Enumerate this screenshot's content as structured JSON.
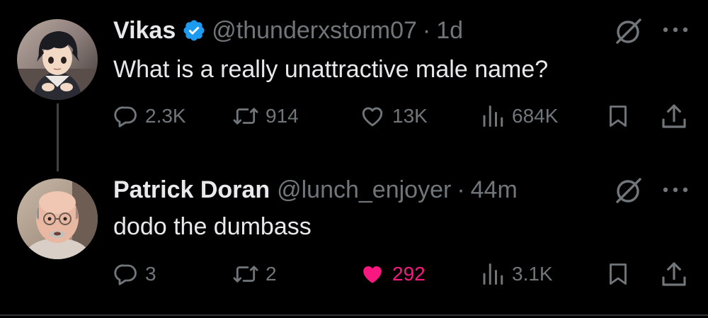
{
  "thread": [
    {
      "author": {
        "name": "Vikas",
        "handle": "@thunderxstorm07",
        "verified": true,
        "avatar": "anime-boy-avatar"
      },
      "time": "1d",
      "text": "What is a really unattractive male name?",
      "actions": {
        "replies": "2.3K",
        "reposts": "914",
        "likes": "13K",
        "liked": false,
        "views": "684K"
      }
    },
    {
      "author": {
        "name": "Patrick Doran",
        "handle": "@lunch_enjoyer",
        "verified": false,
        "avatar": "bald-man-avatar"
      },
      "time": "44m",
      "text": "dodo the dumbass",
      "actions": {
        "replies": "3",
        "reposts": "2",
        "likes": "292",
        "liked": true,
        "views": "3.1K"
      }
    }
  ],
  "separator": "·",
  "colors": {
    "background": "#000000",
    "text": "#e7e9ea",
    "muted": "#71767b",
    "verified": "#1d9bf0",
    "like": "#f91880"
  }
}
